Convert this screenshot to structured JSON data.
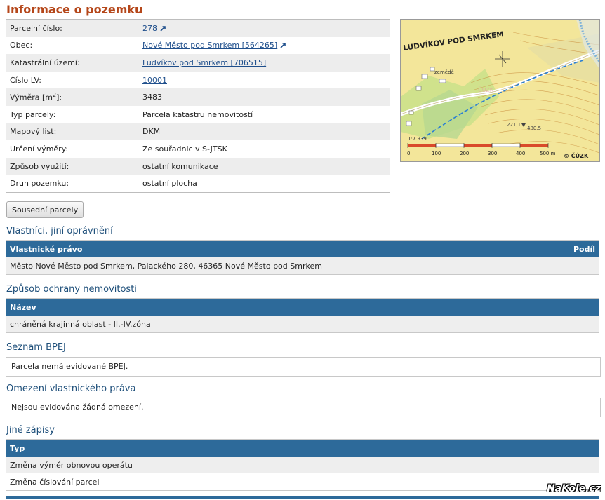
{
  "page_title": "Informace o pozemku",
  "info_rows": [
    {
      "label": "Parcelní číslo:",
      "value": "278",
      "link": true,
      "external": true
    },
    {
      "label": "Obec:",
      "value": "Nové Město pod Smrkem [564265]",
      "link": true,
      "external": true
    },
    {
      "label": "Katastrální území:",
      "value": "Ludvíkov pod Smrkem [706515]",
      "link": true,
      "external": false
    },
    {
      "label": "Číslo LV:",
      "value": "10001",
      "link": true,
      "external": false
    },
    {
      "label_prefix": "Výměra [m",
      "label_sup": "2",
      "label_suffix": "]:",
      "value": "3483",
      "link": false
    },
    {
      "label": "Typ parcely:",
      "value": "Parcela katastru nemovitostí",
      "link": false
    },
    {
      "label": "Mapový list:",
      "value": "DKM",
      "link": false
    },
    {
      "label": "Určení výměry:",
      "value": "Ze souřadnic v S-JTSK",
      "link": false
    },
    {
      "label": "Způsob využití:",
      "value": "ostatní komunikace",
      "link": false
    },
    {
      "label": "Druh pozemku:",
      "value": "ostatní plocha",
      "link": false
    }
  ],
  "map": {
    "place_label": "LUDVÍKOV POD SMRKEM",
    "area_label": "zemědě",
    "ghost_label": "ČÚZK",
    "spot_heights": [
      "221,1",
      "480,5"
    ],
    "scale_ratio": "1:7 939",
    "scale_ticks": [
      "0",
      "100",
      "200",
      "300",
      "400",
      "500 m"
    ],
    "copyright": "© ČÚZK",
    "colors": {
      "base": "#f3e69a",
      "field": "#c9e08a",
      "forest": "#b7d890",
      "contour": "#c98b3a",
      "road": "#ffffff",
      "stream": "#2a7fd4"
    }
  },
  "neighbors_button": "Sousední parcely",
  "owners": {
    "title": "Vlastníci, jiní oprávnění",
    "col1": "Vlastnické právo",
    "col2": "Podíl",
    "rows": [
      "Město Nové Město pod Smrkem, Palackého 280, 46365 Nové Město pod Smrkem"
    ]
  },
  "protection": {
    "title": "Způsob ochrany nemovitosti",
    "col1": "Název",
    "rows": [
      "chráněná krajinná oblast - II.-IV.zóna"
    ]
  },
  "bpej": {
    "title": "Seznam BPEJ",
    "text": "Parcela nemá evidované BPEJ."
  },
  "restrictions": {
    "title": "Omezení vlastnického práva",
    "text": "Nejsou evidována žádná omezení."
  },
  "other": {
    "title": "Jiné zápisy",
    "col1": "Typ",
    "rows": [
      "Změna výměr obnovou operátu",
      "Změna číslování parcel"
    ]
  },
  "watermark": "NaKole.cz",
  "theme": {
    "header_blue": "#2d6a9a",
    "title_orange": "#b5471a",
    "section_blue": "#1e4f7a",
    "link_blue": "#1f4f8c"
  }
}
